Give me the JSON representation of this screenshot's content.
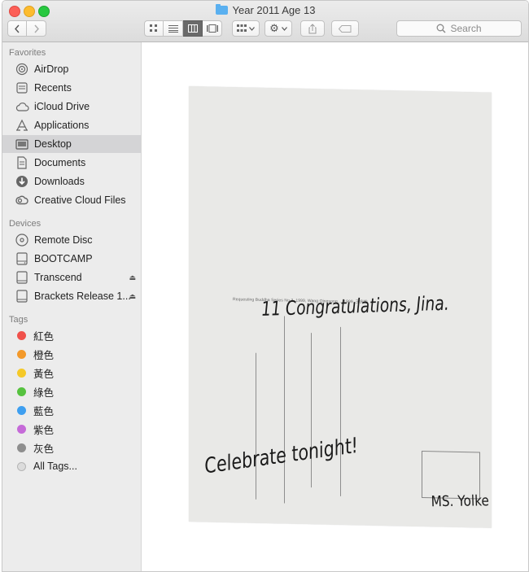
{
  "window": {
    "title": "Year 2011 Age 13"
  },
  "toolbar": {
    "search_placeholder": "Search"
  },
  "sidebar": {
    "favorites_header": "Favorites",
    "favorites": [
      {
        "label": "AirDrop",
        "icon": "airdrop-icon"
      },
      {
        "label": "Recents",
        "icon": "recents-icon"
      },
      {
        "label": "iCloud Drive",
        "icon": "icloud-icon"
      },
      {
        "label": "Applications",
        "icon": "applications-icon"
      },
      {
        "label": "Desktop",
        "icon": "desktop-icon",
        "selected": true
      },
      {
        "label": "Documents",
        "icon": "documents-icon"
      },
      {
        "label": "Downloads",
        "icon": "downloads-icon"
      },
      {
        "label": "Creative Cloud Files",
        "icon": "creative-cloud-icon"
      }
    ],
    "devices_header": "Devices",
    "devices": [
      {
        "label": "Remote Disc",
        "icon": "disc-icon"
      },
      {
        "label": "BOOTCAMP",
        "icon": "drive-icon"
      },
      {
        "label": "Transcend",
        "icon": "external-drive-icon",
        "eject": true
      },
      {
        "label": "Brackets Release 1...",
        "icon": "external-drive-icon",
        "eject": true
      }
    ],
    "tags_header": "Tags",
    "tags": [
      {
        "label": "紅色",
        "color": "#f0514b"
      },
      {
        "label": "橙色",
        "color": "#f3992a"
      },
      {
        "label": "黃色",
        "color": "#f5c928"
      },
      {
        "label": "綠色",
        "color": "#56c23f"
      },
      {
        "label": "藍色",
        "color": "#3e9ff0"
      },
      {
        "label": "紫色",
        "color": "#c56ad8"
      },
      {
        "label": "灰色",
        "color": "#8e8e8e"
      },
      {
        "label": "All Tags...",
        "color": "#dcdcdc"
      }
    ]
  },
  "preview": {
    "printed_caption": "Requesting Buddha Series No.3, 1999, Wang Qingsong   ....1999, 王庆松",
    "greeting": "11 Congratulations, Jina.",
    "message": "Celebrate tonight!",
    "signature": "MS. Yolke"
  }
}
